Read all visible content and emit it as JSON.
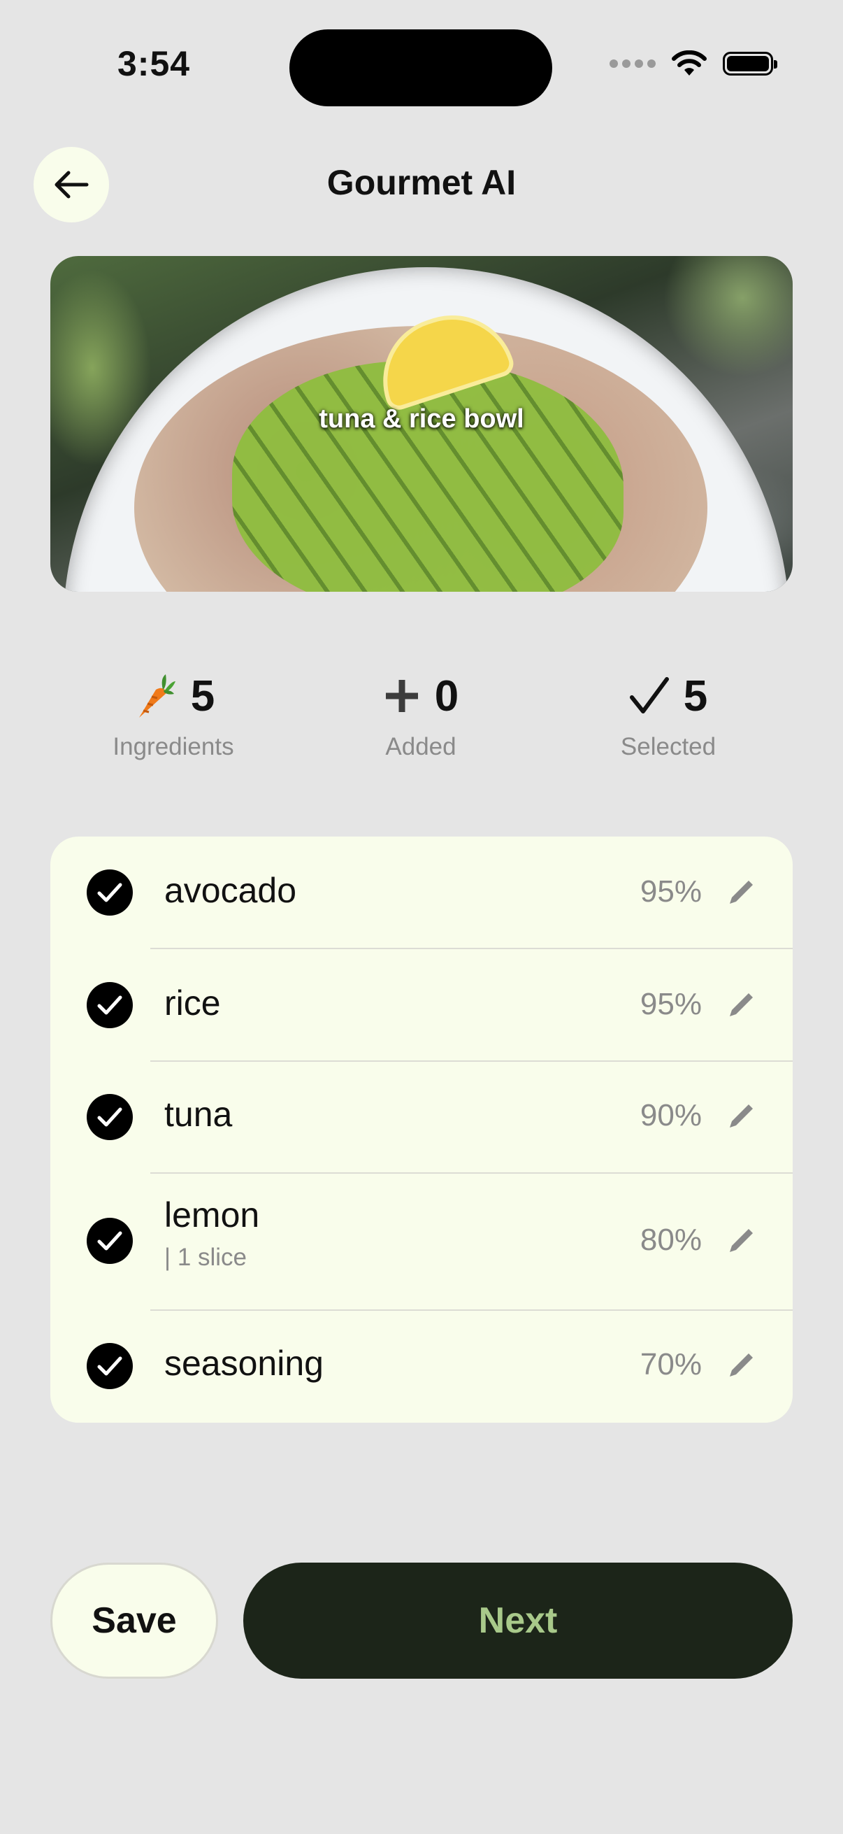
{
  "status_bar": {
    "time": "3:54"
  },
  "header": {
    "title": "Gourmet AI",
    "back_icon": "arrow-left-icon"
  },
  "hero": {
    "caption": "tuna & rice bowl"
  },
  "stats": [
    {
      "icon": "carrot-icon",
      "value": "5",
      "label": "Ingredients"
    },
    {
      "icon": "plus-icon",
      "value": "0",
      "label": "Added"
    },
    {
      "icon": "checkmark-icon",
      "value": "5",
      "label": "Selected"
    }
  ],
  "ingredients": [
    {
      "name": "avocado",
      "detail": "",
      "confidence": "95%",
      "selected": true
    },
    {
      "name": "rice",
      "detail": "",
      "confidence": "95%",
      "selected": true
    },
    {
      "name": "tuna",
      "detail": "",
      "confidence": "90%",
      "selected": true
    },
    {
      "name": "lemon",
      "detail": "| 1 slice",
      "confidence": "80%",
      "selected": true
    },
    {
      "name": "seasoning",
      "detail": "",
      "confidence": "70%",
      "selected": true
    }
  ],
  "actions": {
    "save_label": "Save",
    "next_label": "Next"
  },
  "colors": {
    "background": "#e5e5e5",
    "card": "#f9fdeb",
    "primary_button": "#1c2519",
    "primary_text": "#a8c98a"
  }
}
